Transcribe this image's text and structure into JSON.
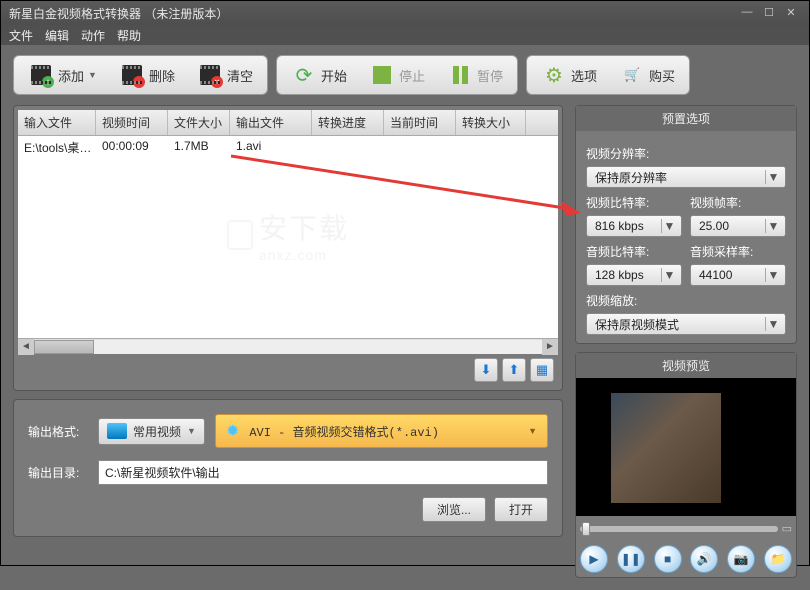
{
  "title": "新星白金视频格式转换器  （未注册版本）",
  "menu": {
    "file": "文件",
    "edit": "编辑",
    "action": "动作",
    "help": "帮助"
  },
  "toolbar": {
    "add": "添加",
    "delete": "删除",
    "clear": "清空",
    "start": "开始",
    "stop": "停止",
    "pause": "暂停",
    "options": "选项",
    "buy": "购买"
  },
  "columns": {
    "c0": "输入文件",
    "c1": "视频时间",
    "c2": "文件大小",
    "c3": "输出文件",
    "c4": "转换进度",
    "c5": "当前时间",
    "c6": "转换大小"
  },
  "row": {
    "c0": "E:\\tools\\桌…",
    "c1": "00:00:09",
    "c2": "1.7MB",
    "c3": "1.avi",
    "c4": "",
    "c5": "",
    "c6": ""
  },
  "watermark": {
    "main": "安下载",
    "sub": "anxz.com"
  },
  "output": {
    "formatLabel": "输出格式:",
    "category": "常用视频",
    "formatText": "AVI - 音频视频交错格式(*.avi)",
    "dirLabel": "输出目录:",
    "dirValue": "C:\\新星视频软件\\输出",
    "browse": "浏览...",
    "open": "打开"
  },
  "preset": {
    "header": "预置选项",
    "resLabel": "视频分辨率:",
    "resValue": "保持原分辨率",
    "vbrLabel": "视频比特率:",
    "vbrValue": "816 kbps",
    "fpsLabel": "视频帧率:",
    "fpsValue": "25.00",
    "abrLabel": "音频比特率:",
    "abrValue": "128 kbps",
    "arLabel": "音频采样率:",
    "arValue": "44100",
    "scaleLabel": "视频缩放:",
    "scaleValue": "保持原视频模式"
  },
  "preview": {
    "header": "视频预览"
  }
}
